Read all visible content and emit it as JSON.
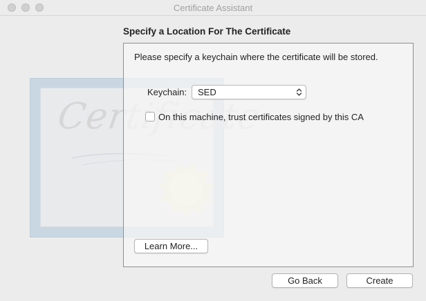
{
  "window": {
    "title": "Certificate Assistant"
  },
  "artwork": {
    "word": "Certificate"
  },
  "page": {
    "heading": "Specify a Location For The Certificate",
    "description": "Please specify a keychain where the certificate will be stored.",
    "keychain_label": "Keychain:",
    "keychain_value": "SED",
    "trust_checkbox_label": "On this machine, trust certificates signed by this CA",
    "trust_checked": false
  },
  "buttons": {
    "learn_more": "Learn More...",
    "go_back": "Go Back",
    "create": "Create"
  }
}
